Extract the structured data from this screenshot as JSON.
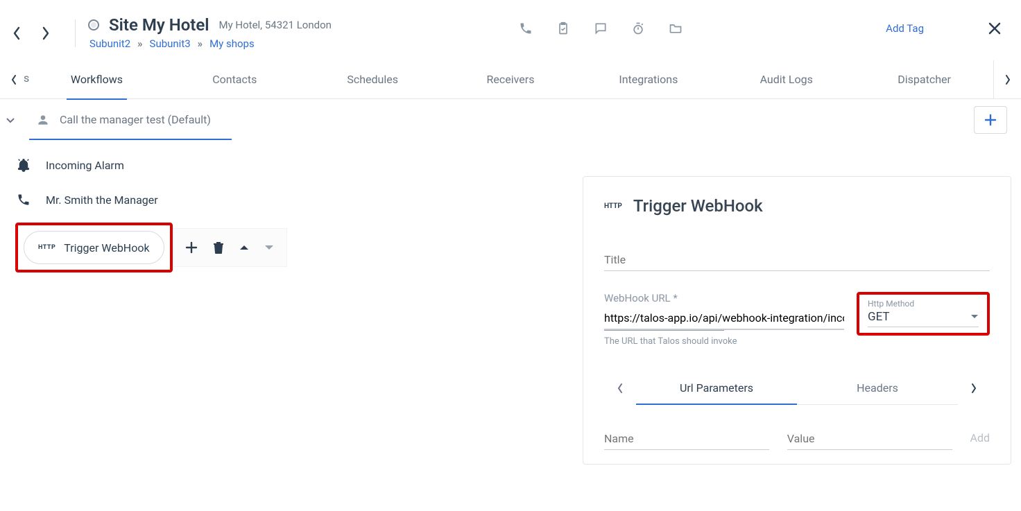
{
  "header": {
    "site_title": "Site My Hotel",
    "site_sub": "My Hotel, 54321 London",
    "add_tag": "Add Tag",
    "breadcrumb": [
      "Subunit2",
      "Subunit3",
      "My shops"
    ]
  },
  "tabs": {
    "corner_letter": "s",
    "items": [
      "Workflows",
      "Contacts",
      "Schedules",
      "Receivers",
      "Integrations",
      "Audit Logs",
      "Dispatcher"
    ],
    "active": "Workflows"
  },
  "subtab": {
    "label": "Call the manager test (Default)"
  },
  "steps": {
    "alarm": "Incoming Alarm",
    "contact": "Mr. Smith the Manager",
    "webhook": "Trigger WebHook"
  },
  "webhook_panel": {
    "title": "Trigger WebHook",
    "title_field_label": "Title",
    "title_field_value": "",
    "url_label": "WebHook URL *",
    "url_value": "https://talos-app.io/api/webhook-integration/incoming",
    "url_helper": "The URL that Talos should invoke",
    "method_label": "Http Method",
    "method_value": "GET",
    "tabs": [
      "Url Parameters",
      "Headers"
    ],
    "active_tab": "Url Parameters",
    "param_name_label": "Name",
    "param_value_label": "Value",
    "add_label": "Add"
  }
}
